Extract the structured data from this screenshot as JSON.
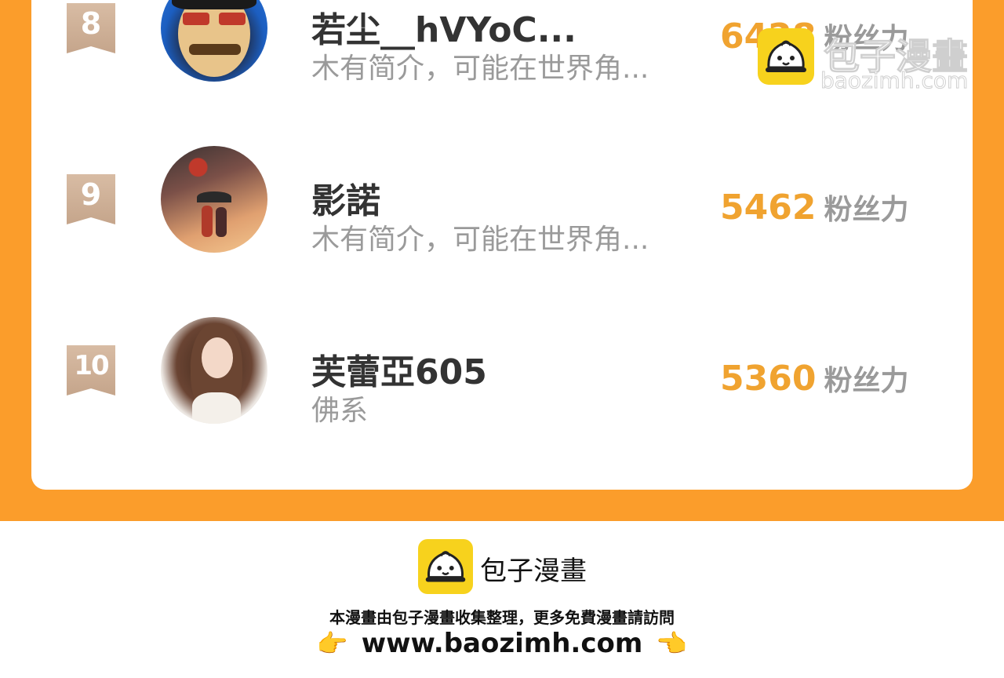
{
  "ranking": [
    {
      "rank": "8",
      "name": "若尘__hVYoC...",
      "bio": "木有简介，可能在世界角...",
      "fans": "6428",
      "fans_unit": "粉丝力"
    },
    {
      "rank": "9",
      "name": "影諾",
      "bio": "木有简介，可能在世界角...",
      "fans": "5462",
      "fans_unit": "粉丝力"
    },
    {
      "rank": "10",
      "name": "芙蕾亞605",
      "bio": "佛系",
      "fans": "5360",
      "fans_unit": "粉丝力"
    }
  ],
  "watermark": {
    "title": "包子漫畫",
    "url": "baozimh.com"
  },
  "footer": {
    "brand": "包子漫畫",
    "note": "本漫畫由包子漫畫收集整理，更多免費漫畫請訪問",
    "url": "www.baozimh.com",
    "hand_left": "👉",
    "hand_right": "👈"
  },
  "colors": {
    "orange": "#fb9d2b",
    "fans_number": "#f0a330",
    "badge": "#c5a58b",
    "logo_yellow": "#f7d21d"
  }
}
